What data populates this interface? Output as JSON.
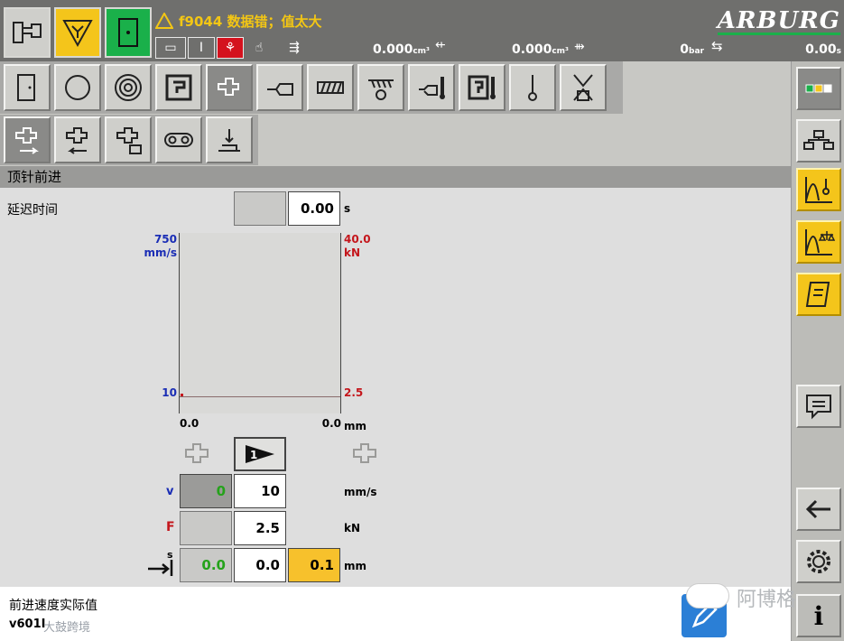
{
  "alarm": {
    "code_text": "f9044 数据错；值太大"
  },
  "brand": {
    "logo_text": "ARBURG"
  },
  "status": {
    "value1": "0.000",
    "unit1": "cm³",
    "value2": "0.000",
    "unit2": "cm³",
    "value3": "0",
    "unit3": "bar",
    "value4": "0.00",
    "unit4": "s"
  },
  "section": {
    "title": "顶针前进"
  },
  "delay": {
    "label": "延迟时间",
    "value": "0.00",
    "unit": "s"
  },
  "chart_data": {
    "type": "line",
    "left_axis": {
      "max": "750",
      "max_unit": "mm/s",
      "min": "10",
      "color": "#1a2db5"
    },
    "right_axis": {
      "max": "40.0",
      "max_unit": "kN",
      "min": "2.5",
      "color": "#c4161c"
    },
    "x_axis": {
      "start": "0.0",
      "end": "0.0",
      "unit": "mm"
    },
    "series": []
  },
  "params": {
    "v_label": "v",
    "v_actual": "0",
    "v_set": "10",
    "v_unit": "mm/s",
    "f_label": "F",
    "f_set": "2.5",
    "f_unit": "kN",
    "s_label": "s",
    "s_actual": "0.0",
    "s_set": "0.0",
    "s_tol": "0.1",
    "s_unit": "mm"
  },
  "footer": {
    "description": "前进速度实际值",
    "code": "v601I"
  },
  "watermark": {
    "brand_text": "阿博格",
    "small_text": "大鼓跨境"
  }
}
